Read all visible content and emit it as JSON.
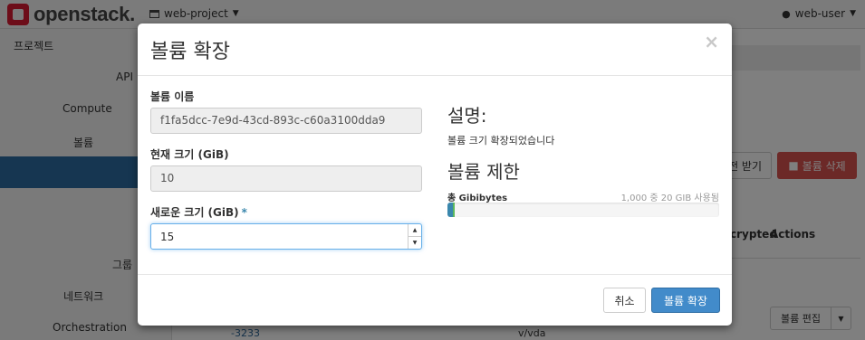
{
  "app": {
    "logo_text": "openstack.",
    "project_switcher": "web-project",
    "user_menu": "web-user",
    "accent_color": "#da1a32"
  },
  "sidebar": {
    "items": [
      {
        "label": "프로젝트"
      },
      {
        "label": "API"
      },
      {
        "label": "Compute"
      },
      {
        "label": "볼륨"
      },
      {
        "label": "그룹"
      },
      {
        "label": "네트워크"
      },
      {
        "label": "Orchestration"
      }
    ]
  },
  "background": {
    "action_button_1": "전 받기",
    "delete_button": "볼륨 삭제",
    "columns": [
      "crypted",
      "Actions"
    ],
    "edit_volume_button": "볼륨 편집",
    "row_link": "-3233",
    "row_attached_to": "v/vda"
  },
  "modal": {
    "title": "볼륨 확장",
    "close_symbol": "×",
    "name_label": "볼륨 이름",
    "name_value": "f1fa5dcc-7e9d-43cd-893c-c60a3100dda9",
    "current_size_label": "현재 크기 (GiB)",
    "current_size_value": "10",
    "new_size_label": "새로운 크기 (GiB)",
    "required_mark": "*",
    "new_size_value": "15",
    "description_heading": "설명:",
    "description_text": "볼륨 크기 확장되었습니다",
    "limits_heading": "볼륨 제한",
    "quota_label": "총 Gibibytes",
    "quota_usage": "1,000 중 20 GIB 사용됨",
    "quota_used_fraction": 0.02,
    "quota_extra_fraction": 0.005,
    "cancel_button": "취소",
    "submit_button": "볼륨 확장"
  }
}
